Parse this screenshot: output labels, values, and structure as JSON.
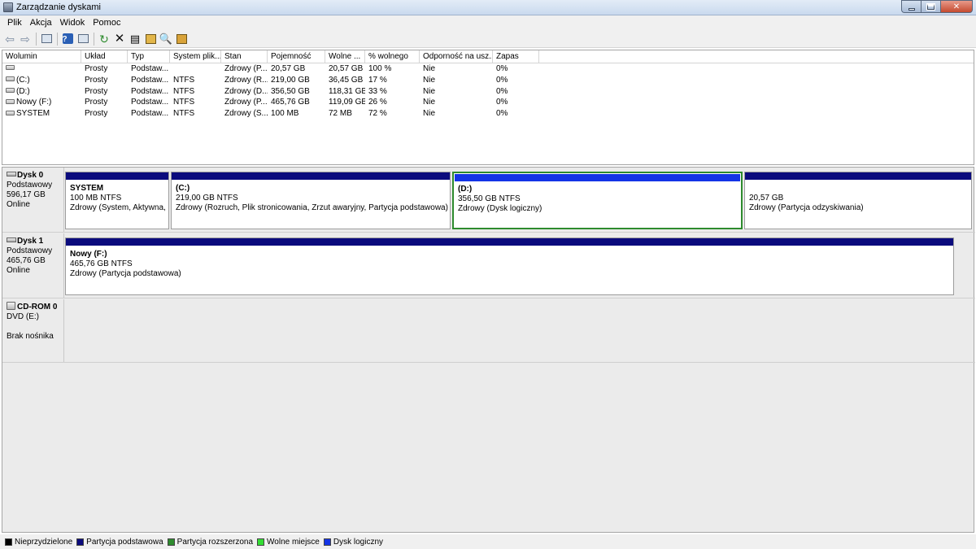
{
  "window": {
    "title": "Zarządzanie dyskami"
  },
  "menu": [
    "Plik",
    "Akcja",
    "Widok",
    "Pomoc"
  ],
  "toolbar_icons": [
    "back-icon",
    "forward-icon",
    "show-hide-console-tree-icon",
    "help-icon",
    "properties-icon",
    "refresh-icon",
    "delete-icon",
    "properties-sheet-icon",
    "open-folder-icon",
    "explore-icon",
    "manage-icon"
  ],
  "list": {
    "columns": [
      "Wolumin",
      "Układ",
      "Typ",
      "System plik...",
      "Stan",
      "Pojemność",
      "Wolne ...",
      "% wolnego",
      "Odporność na usz...",
      "Zapas"
    ],
    "rows": [
      [
        "",
        "Prosty",
        "Podstaw...",
        "",
        "Zdrowy (P...",
        "20,57 GB",
        "20,57 GB",
        "100 %",
        "Nie",
        "0%"
      ],
      [
        "(C:)",
        "Prosty",
        "Podstaw...",
        "NTFS",
        "Zdrowy (R...",
        "219,00 GB",
        "36,45 GB",
        "17 %",
        "Nie",
        "0%"
      ],
      [
        "(D:)",
        "Prosty",
        "Podstaw...",
        "NTFS",
        "Zdrowy (D...",
        "356,50 GB",
        "118,31 GB",
        "33 %",
        "Nie",
        "0%"
      ],
      [
        "Nowy (F:)",
        "Prosty",
        "Podstaw...",
        "NTFS",
        "Zdrowy (P...",
        "465,76 GB",
        "119,09 GB",
        "26 %",
        "Nie",
        "0%"
      ],
      [
        "SYSTEM",
        "Prosty",
        "Podstaw...",
        "NTFS",
        "Zdrowy (S...",
        "100 MB",
        "72 MB",
        "72 %",
        "Nie",
        "0%"
      ]
    ]
  },
  "disks": [
    {
      "name": "Dysk 0",
      "type": "Podstawowy",
      "size": "596,17 GB",
      "status": "Online",
      "partitions": [
        {
          "name": "SYSTEM",
          "size": "100 MB NTFS",
          "status": "Zdrowy (System, Aktywna, Pa"
        },
        {
          "name": "(C:)",
          "size": "219,00 GB NTFS",
          "status": "Zdrowy (Rozruch, Plik stronicowania, Zrzut awaryjny, Partycja podstawowa)"
        },
        {
          "name": "(D:)",
          "size": "356,50 GB NTFS",
          "status": "Zdrowy (Dysk logiczny)"
        },
        {
          "name": "",
          "size": "20,57 GB",
          "status": "Zdrowy (Partycja odzyskiwania)"
        }
      ]
    },
    {
      "name": "Dysk 1",
      "type": "Podstawowy",
      "size": "465,76 GB",
      "status": "Online",
      "partitions": [
        {
          "name": "Nowy  (F:)",
          "size": "465,76 GB NTFS",
          "status": "Zdrowy (Partycja podstawowa)"
        }
      ]
    },
    {
      "name": "CD-ROM 0",
      "type": "DVD (E:)",
      "status": "Brak nośnika"
    }
  ],
  "legend": [
    {
      "label": "Nieprzydzielone",
      "color": "#000000"
    },
    {
      "label": "Partycja podstawowa",
      "color": "#0b0b7d"
    },
    {
      "label": "Partycja rozszerzona",
      "color": "#2e8b2e"
    },
    {
      "label": "Wolne miejsce",
      "color": "#33dd33"
    },
    {
      "label": "Dysk logiczny",
      "color": "#1434e6"
    }
  ]
}
